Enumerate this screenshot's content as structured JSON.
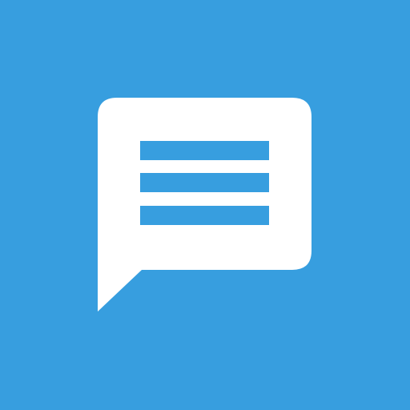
{
  "icon": {
    "name": "chat-bubble-icon",
    "background_color": "#379EDF",
    "bubble_color": "#FFFFFF",
    "line_color": "#379EDF"
  }
}
